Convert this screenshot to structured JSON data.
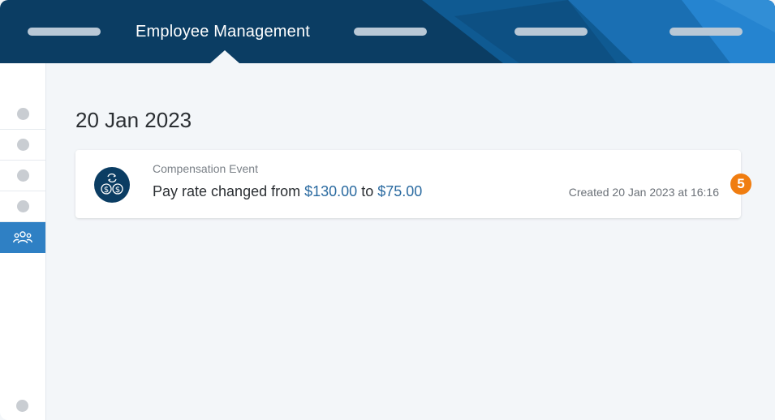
{
  "header": {
    "title": "Employee Management",
    "colors": {
      "primary": "#0b3d63",
      "accent": "#1f7ac7"
    }
  },
  "sidebar": {
    "items": [
      {
        "name": "nav-item-1",
        "active": false
      },
      {
        "name": "nav-item-2",
        "active": false
      },
      {
        "name": "nav-item-3",
        "active": false
      },
      {
        "name": "nav-item-4",
        "active": false
      },
      {
        "name": "people",
        "icon": "people-icon",
        "active": true
      }
    ],
    "active_color": "#2f80c4"
  },
  "main": {
    "date_heading": "20 Jan 2023",
    "event": {
      "type": "Compensation Event",
      "desc_prefix": "Pay rate changed from ",
      "from_amount": "$130.00",
      "desc_middle": " to ",
      "to_amount": "$75.00",
      "created": "Created 20 Jan 2023 at 16:16",
      "icon": "currency-exchange-icon"
    },
    "badge": "5",
    "badge_color": "#f07d10"
  }
}
